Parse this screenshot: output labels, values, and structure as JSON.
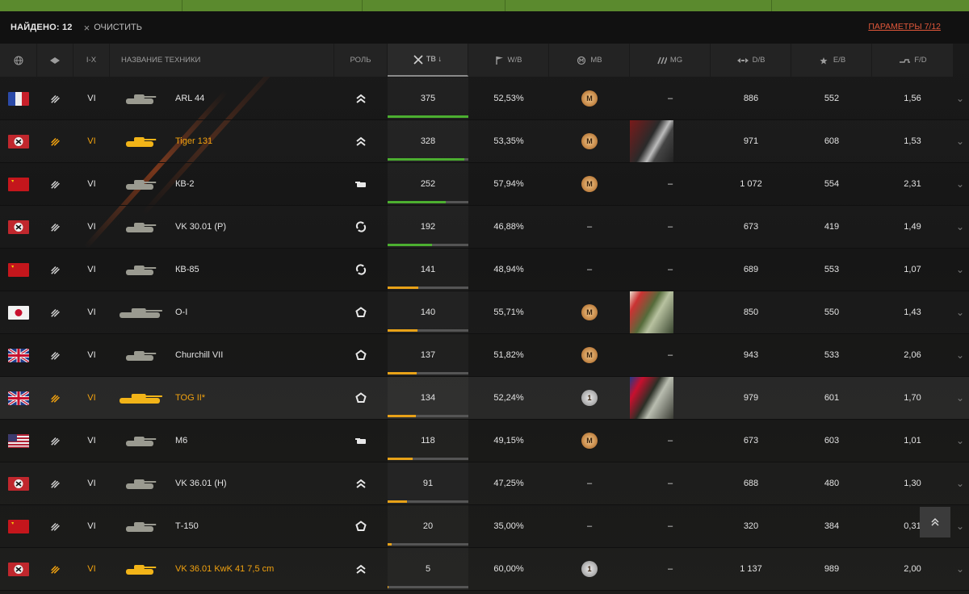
{
  "filter": {
    "found_label": "НАЙДЕНО: 12",
    "clear_label": "ОЧИСТИТЬ",
    "params_label": "ПАРАМЕТРЫ 7/12"
  },
  "columns": {
    "nation": "",
    "type": "",
    "tier": "I-X",
    "name": "НАЗВАНИЕ ТЕХНИКИ",
    "role": "РОЛЬ",
    "tb": "ТВ ↓",
    "wb": "W/B",
    "mb": "MB",
    "mg": "MG",
    "db": "D/B",
    "eb": "E/B",
    "fd": "F/D"
  },
  "colors": {
    "premium": "#f2a20f",
    "accent_red": "#e0573a",
    "bar_green": "#4caf30",
    "bar_orange": "#e8a218",
    "nav_green": "#5b8a2e"
  },
  "rows": [
    {
      "nation": "france",
      "premium": false,
      "tier": "VI",
      "name": "ARL 44",
      "role": "role-chevrons",
      "tb": "375",
      "tb_frac": 1.0,
      "bar_color": "green",
      "wb": "52,53%",
      "mb": "M",
      "mb_style": "bronze",
      "mg": "–",
      "mg_mark": "",
      "db": "886",
      "eb": "552",
      "fd": "1,56"
    },
    {
      "nation": "germany",
      "premium": true,
      "tier": "VI",
      "name": "Tiger 131",
      "role": "role-chevrons",
      "tb": "328",
      "tb_frac": 0.95,
      "bar_color": "green",
      "wb": "53,35%",
      "mb": "M",
      "mb_style": "bronze",
      "mg": "",
      "mg_mark": "germany",
      "db": "971",
      "eb": "608",
      "fd": "1,53"
    },
    {
      "nation": "ussr",
      "premium": false,
      "tier": "VI",
      "name": "КВ-2",
      "role": "role-gun",
      "tb": "252",
      "tb_frac": 0.72,
      "bar_color": "green",
      "wb": "57,94%",
      "mb": "M",
      "mb_style": "bronze",
      "mg": "–",
      "mg_mark": "",
      "db": "1 072",
      "eb": "554",
      "fd": "2,31"
    },
    {
      "nation": "germany",
      "premium": false,
      "tier": "VI",
      "name": "VK 30.01 (P)",
      "role": "role-cycle",
      "tb": "192",
      "tb_frac": 0.55,
      "bar_color": "green",
      "wb": "46,88%",
      "mb": "–",
      "mb_style": "none",
      "mg": "–",
      "mg_mark": "",
      "db": "673",
      "eb": "419",
      "fd": "1,49"
    },
    {
      "nation": "ussr",
      "premium": false,
      "tier": "VI",
      "name": "КВ-85",
      "role": "role-cycle",
      "tb": "141",
      "tb_frac": 0.38,
      "bar_color": "orange",
      "wb": "48,94%",
      "mb": "–",
      "mb_style": "none",
      "mg": "–",
      "mg_mark": "",
      "db": "689",
      "eb": "553",
      "fd": "1,07"
    },
    {
      "nation": "japan",
      "premium": false,
      "tier": "VI",
      "name": "O-I",
      "role": "role-pentagon",
      "tb": "140",
      "tb_frac": 0.37,
      "bar_color": "orange",
      "wb": "55,71%",
      "mb": "M",
      "mb_style": "bronze",
      "mg": "",
      "mg_mark": "japan",
      "db": "850",
      "eb": "550",
      "fd": "1,43"
    },
    {
      "nation": "uk",
      "premium": false,
      "tier": "VI",
      "name": "Churchill VII",
      "role": "role-pentagon",
      "tb": "137",
      "tb_frac": 0.36,
      "bar_color": "orange",
      "wb": "51,82%",
      "mb": "M",
      "mb_style": "bronze",
      "mg": "–",
      "mg_mark": "",
      "db": "943",
      "eb": "533",
      "fd": "2,06"
    },
    {
      "nation": "uk",
      "premium": true,
      "tier": "VI",
      "name": "TOG II*",
      "role": "role-pentagon",
      "tb": "134",
      "tb_frac": 0.35,
      "bar_color": "orange",
      "wb": "52,24%",
      "mb": "1",
      "mb_style": "silver",
      "mg": "",
      "mg_mark": "uk",
      "db": "979",
      "eb": "601",
      "fd": "1,70"
    },
    {
      "nation": "usa",
      "premium": false,
      "tier": "VI",
      "name": "M6",
      "role": "role-gun",
      "tb": "118",
      "tb_frac": 0.31,
      "bar_color": "orange",
      "wb": "49,15%",
      "mb": "M",
      "mb_style": "bronze",
      "mg": "–",
      "mg_mark": "",
      "db": "673",
      "eb": "603",
      "fd": "1,01"
    },
    {
      "nation": "germany",
      "premium": false,
      "tier": "VI",
      "name": "VK 36.01 (H)",
      "role": "role-chevrons",
      "tb": "91",
      "tb_frac": 0.24,
      "bar_color": "orange",
      "wb": "47,25%",
      "mb": "–",
      "mb_style": "none",
      "mg": "–",
      "mg_mark": "",
      "db": "688",
      "eb": "480",
      "fd": "1,30"
    },
    {
      "nation": "ussr",
      "premium": false,
      "tier": "VI",
      "name": "Т-150",
      "role": "role-pentagon",
      "tb": "20",
      "tb_frac": 0.05,
      "bar_color": "orange",
      "wb": "35,00%",
      "mb": "–",
      "mb_style": "none",
      "mg": "–",
      "mg_mark": "",
      "db": "320",
      "eb": "384",
      "fd": "0,31"
    },
    {
      "nation": "germany",
      "premium": true,
      "tier": "VI",
      "name": "VK 36.01 KwK 41 7,5 cm",
      "role": "role-chevrons",
      "tb": "5",
      "tb_frac": 0.01,
      "bar_color": "orange",
      "wb": "60,00%",
      "mb": "1",
      "mb_style": "silver",
      "mg": "–",
      "mg_mark": "",
      "db": "1 137",
      "eb": "989",
      "fd": "2,00"
    }
  ],
  "scroll_up_icon": "double-chevron-up-icon"
}
